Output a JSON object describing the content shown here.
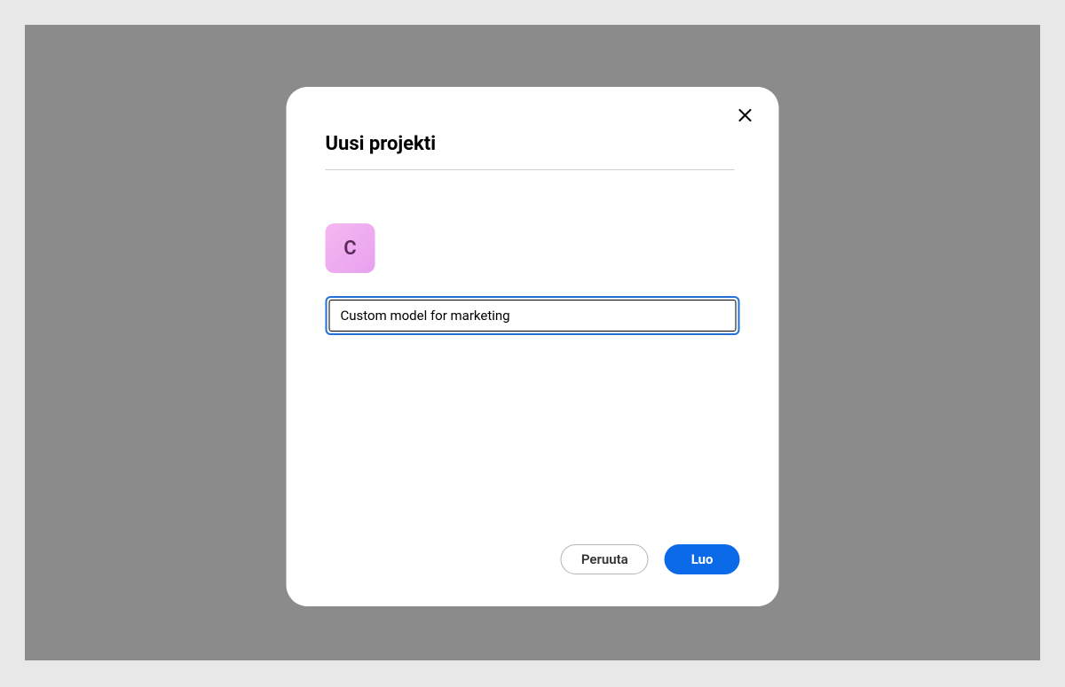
{
  "modal": {
    "title": "Uusi projekti",
    "project_letter": "C",
    "name_input_value": "Custom model for marketing",
    "cancel_label": "Peruuta",
    "create_label": "Luo"
  }
}
